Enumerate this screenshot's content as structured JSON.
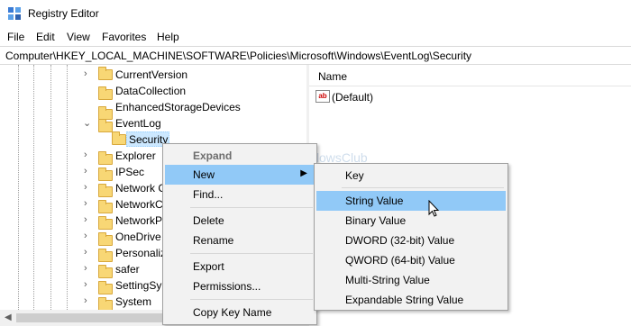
{
  "window": {
    "title": "Registry Editor"
  },
  "menubar": [
    "File",
    "Edit",
    "View",
    "Favorites",
    "Help"
  ],
  "address": "Computer\\HKEY_LOCAL_MACHINE\\SOFTWARE\\Policies\\Microsoft\\Windows\\EventLog\\Security",
  "tree": [
    {
      "label": "CurrentVersion"
    },
    {
      "label": "DataCollection"
    },
    {
      "label": "EnhancedStorageDevices"
    },
    {
      "label": "EventLog"
    },
    {
      "label": "Security"
    },
    {
      "label": "Explorer"
    },
    {
      "label": "IPSec"
    },
    {
      "label": "Network C"
    },
    {
      "label": "NetworkC"
    },
    {
      "label": "NetworkP"
    },
    {
      "label": "OneDrive"
    },
    {
      "label": "Personaliz"
    },
    {
      "label": "safer"
    },
    {
      "label": "SettingSyr"
    },
    {
      "label": "System"
    }
  ],
  "values_pane": {
    "column_name": "Name",
    "entries": [
      {
        "name": "(Default)",
        "icon": "ab-string-icon"
      }
    ]
  },
  "watermark": "TheWindowsClub",
  "context_menu": {
    "items": [
      "Expand",
      "New",
      "Find...",
      "Delete",
      "Rename",
      "Export",
      "Permissions...",
      "Copy Key Name"
    ],
    "highlighted": "New"
  },
  "new_submenu": {
    "items": [
      "Key",
      "String Value",
      "Binary Value",
      "DWORD (32-bit) Value",
      "QWORD (64-bit) Value",
      "Multi-String Value",
      "Expandable String Value"
    ],
    "highlighted": "String Value"
  },
  "colors": {
    "highlight": "#91c9f7",
    "selection": "#cce8ff",
    "folder": "#f8d775"
  }
}
